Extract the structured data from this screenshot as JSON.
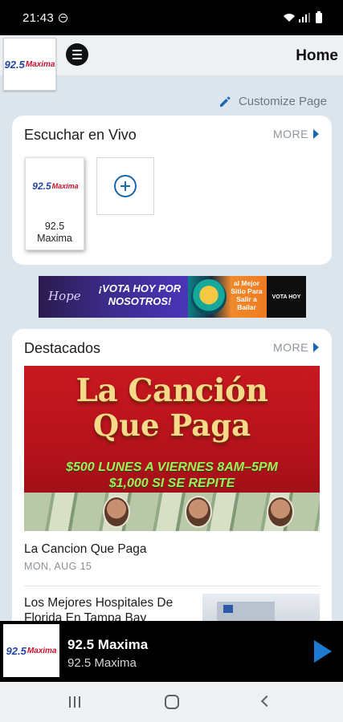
{
  "status_bar": {
    "time": "21:43"
  },
  "header": {
    "title": "Home",
    "logo_text_num": "92.5",
    "logo_text_word": "Maxima"
  },
  "customize": {
    "label": "Customize Page"
  },
  "live_section": {
    "title": "Escuchar en Vivo",
    "more_label": "MORE",
    "stations": [
      {
        "label": "92.5 Maxima"
      }
    ]
  },
  "banner_ad": {
    "script_text": "Hope",
    "vote_text": "¡VOTA HOY POR NOSOTROS!",
    "best_text": "al Mejor Sitio Para Salir a Bailar",
    "right_text": "VOTA HOY"
  },
  "featured": {
    "title": "Destacados",
    "more_label": "MORE",
    "image": {
      "line_title_1": "La Canción",
      "line_title_2": "Que Paga",
      "line_prize_1": "$500 LUNES A VIERNES 8AM–5PM",
      "line_prize_2": "$1,000 SI SE REPITE"
    },
    "items": [
      {
        "title": "La Cancion Que Paga",
        "date": "MON, AUG 15"
      },
      {
        "title": "Los Mejores Hospitales De Florida En Tampa Bay"
      }
    ]
  },
  "now_playing": {
    "title": "92.5 Maxima",
    "subtitle": "92.5 Maxima"
  },
  "colors": {
    "accent": "#1868b0",
    "play": "#1e7ad1",
    "brand_red": "#c8102e",
    "brand_blue": "#2346a4"
  }
}
